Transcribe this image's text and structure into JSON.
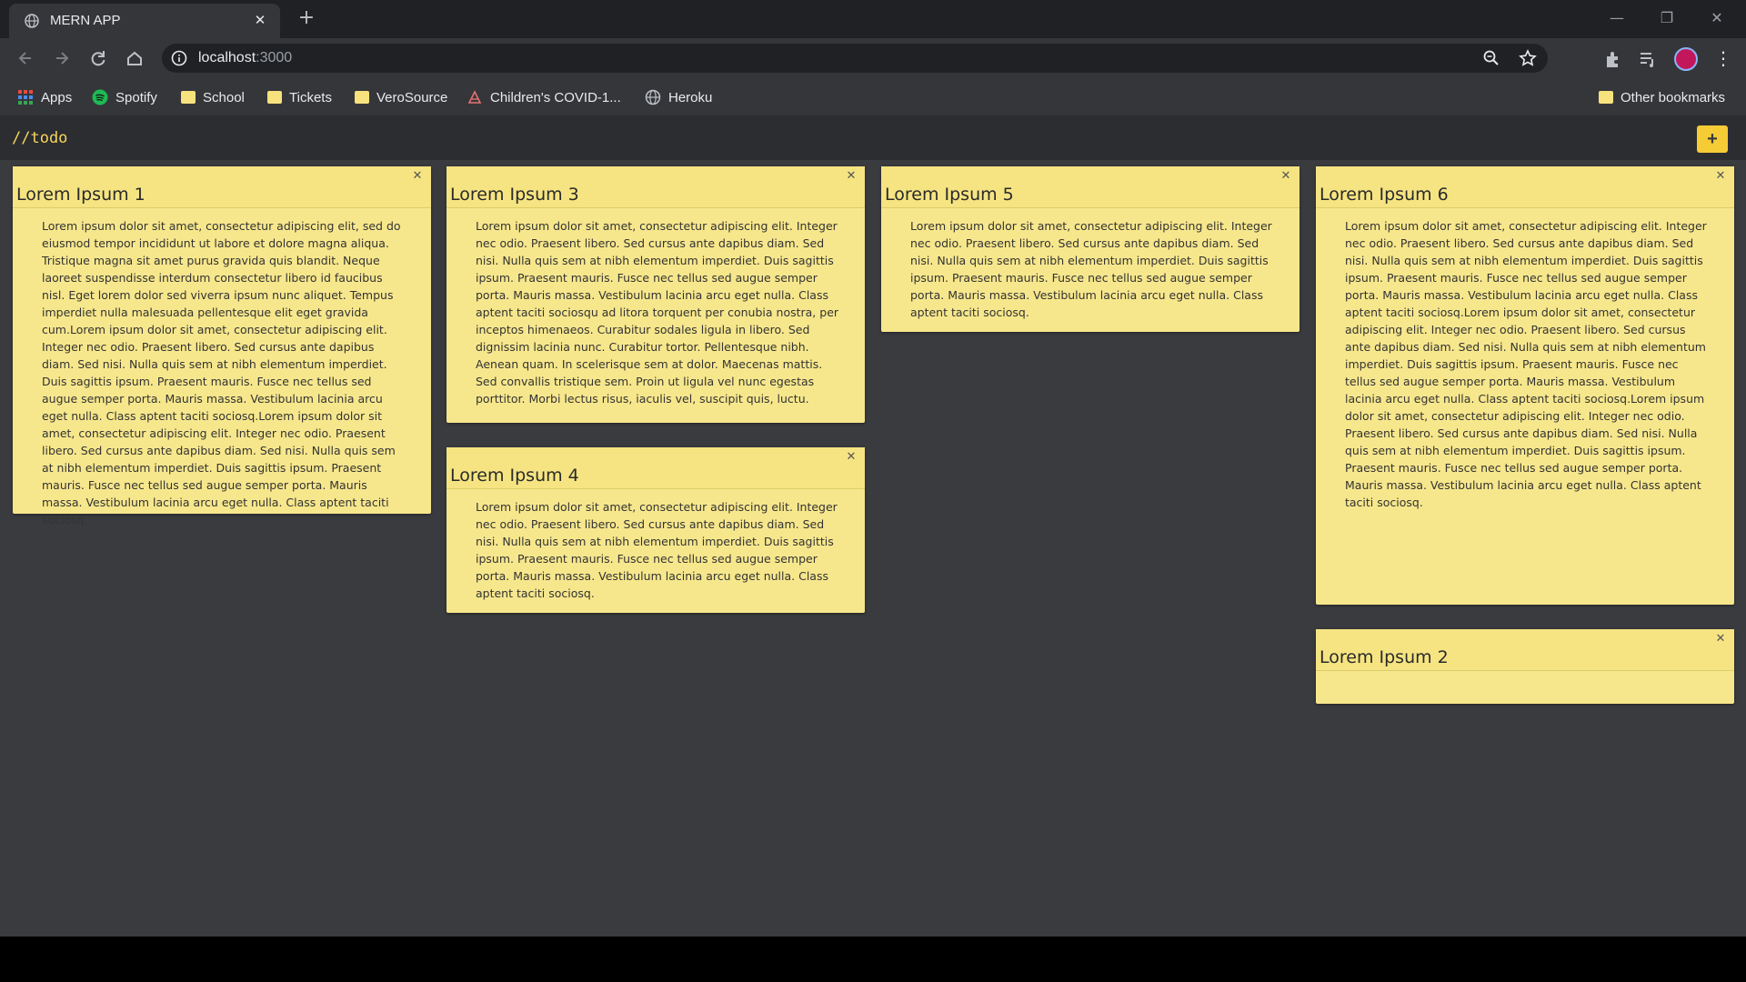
{
  "browser": {
    "tab_title": "MERN APP",
    "tab_close": "✕",
    "new_tab": "+",
    "url_host": "localhost",
    "url_port": ":3000",
    "window_controls": {
      "minimize": "—",
      "restore": "❐",
      "close": "✕"
    },
    "menu": "⋮"
  },
  "bookmarks": [
    {
      "label": "Apps",
      "icon": "apps-grid-icon"
    },
    {
      "label": "Spotify",
      "icon": "spotify-icon"
    },
    {
      "label": "School",
      "icon": "folder-icon"
    },
    {
      "label": "Tickets",
      "icon": "folder-icon"
    },
    {
      "label": "VeroSource",
      "icon": "folder-icon"
    },
    {
      "label": "Children's COVID-1...",
      "icon": "site-icon"
    },
    {
      "label": "Heroku",
      "icon": "globe-icon"
    }
  ],
  "other_bookmarks": "Other bookmarks",
  "app": {
    "brand": "//todo",
    "add_label": "+",
    "accent": "#f6cc36",
    "note_color": "#f7e78c"
  },
  "notes": [
    {
      "title": "Lorem Ipsum 1",
      "close": "✕",
      "body": "Lorem ipsum dolor sit amet, consectetur adipiscing elit, sed do eiusmod tempor incididunt ut labore et dolore magna aliqua. Tristique magna sit amet purus gravida quis blandit. Neque laoreet suspendisse interdum consectetur libero id faucibus nisl. Eget lorem dolor sed viverra ipsum nunc aliquet. Tempus imperdiet nulla malesuada pellentesque elit eget gravida cum.Lorem ipsum dolor sit amet, consectetur adipiscing elit. Integer nec odio. Praesent libero. Sed cursus ante dapibus diam. Sed nisi. Nulla quis sem at nibh elementum imperdiet. Duis sagittis ipsum. Praesent mauris. Fusce nec tellus sed augue semper porta. Mauris massa. Vestibulum lacinia arcu eget nulla. Class aptent taciti sociosq.Lorem ipsum dolor sit amet, consectetur adipiscing elit. Integer nec odio. Praesent libero. Sed cursus ante dapibus diam. Sed nisi. Nulla quis sem at nibh elementum imperdiet. Duis sagittis ipsum. Praesent mauris. Fusce nec tellus sed augue semper porta. Mauris massa. Vestibulum lacinia arcu eget nulla. Class aptent taciti sociosq."
    },
    {
      "title": "Lorem Ipsum 3",
      "close": "✕",
      "body": "Lorem ipsum dolor sit amet, consectetur adipiscing elit. Integer nec odio. Praesent libero. Sed cursus ante dapibus diam. Sed nisi. Nulla quis sem at nibh elementum imperdiet. Duis sagittis ipsum. Praesent mauris. Fusce nec tellus sed augue semper porta. Mauris massa. Vestibulum lacinia arcu eget nulla. Class aptent taciti sociosqu ad litora torquent per conubia nostra, per inceptos himenaeos. Curabitur sodales ligula in libero. Sed dignissim lacinia nunc. Curabitur tortor. Pellentesque nibh. Aenean quam. In scelerisque sem at dolor. Maecenas mattis. Sed convallis tristique sem. Proin ut ligula vel nunc egestas porttitor. Morbi lectus risus, iaculis vel, suscipit quis, luctu."
    },
    {
      "title": "Lorem Ipsum 4",
      "close": "✕",
      "body": "Lorem ipsum dolor sit amet, consectetur adipiscing elit. Integer nec odio. Praesent libero. Sed cursus ante dapibus diam. Sed nisi. Nulla quis sem at nibh elementum imperdiet. Duis sagittis ipsum. Praesent mauris. Fusce nec tellus sed augue semper porta. Mauris massa. Vestibulum lacinia arcu eget nulla. Class aptent taciti sociosq."
    },
    {
      "title": "Lorem Ipsum 5",
      "close": "✕",
      "body": "Lorem ipsum dolor sit amet, consectetur adipiscing elit. Integer nec odio. Praesent libero. Sed cursus ante dapibus diam. Sed nisi. Nulla quis sem at nibh elementum imperdiet. Duis sagittis ipsum. Praesent mauris. Fusce nec tellus sed augue semper porta. Mauris massa. Vestibulum lacinia arcu eget nulla. Class aptent taciti sociosq."
    },
    {
      "title": "Lorem Ipsum 6",
      "close": "✕",
      "body": "Lorem ipsum dolor sit amet, consectetur adipiscing elit. Integer nec odio. Praesent libero. Sed cursus ante dapibus diam. Sed nisi. Nulla quis sem at nibh elementum imperdiet. Duis sagittis ipsum. Praesent mauris. Fusce nec tellus sed augue semper porta. Mauris massa. Vestibulum lacinia arcu eget nulla. Class aptent taciti sociosq.Lorem ipsum dolor sit amet, consectetur adipiscing elit. Integer nec odio. Praesent libero. Sed cursus ante dapibus diam. Sed nisi. Nulla quis sem at nibh elementum imperdiet. Duis sagittis ipsum. Praesent mauris. Fusce nec tellus sed augue semper porta. Mauris massa. Vestibulum lacinia arcu eget nulla. Class aptent taciti sociosq.Lorem ipsum dolor sit amet, consectetur adipiscing elit. Integer nec odio. Praesent libero. Sed cursus ante dapibus diam. Sed nisi. Nulla quis sem at nibh elementum imperdiet. Duis sagittis ipsum. Praesent mauris. Fusce nec tellus sed augue semper porta. Mauris massa. Vestibulum lacinia arcu eget nulla. Class aptent taciti sociosq."
    },
    {
      "title": "Lorem Ipsum 2",
      "close": "✕",
      "body": ""
    }
  ]
}
